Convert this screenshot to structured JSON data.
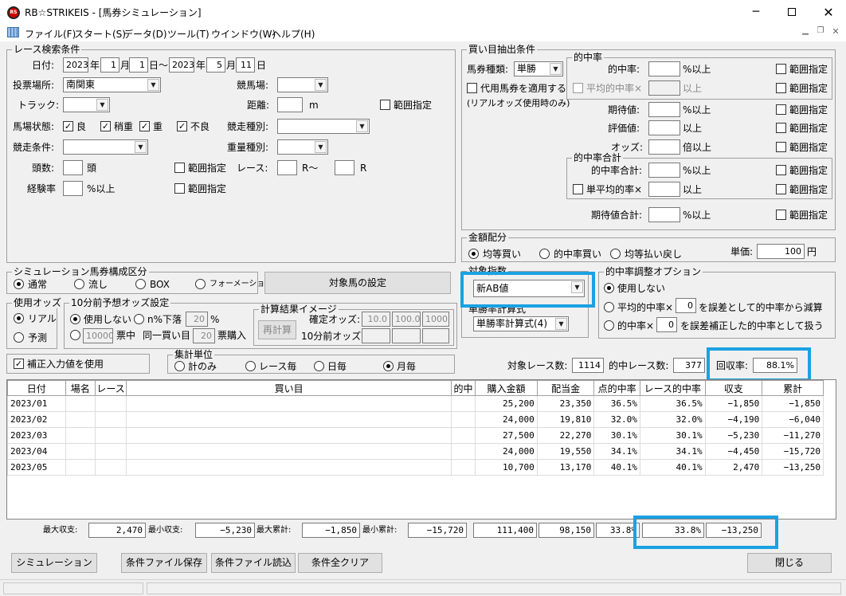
{
  "window": {
    "title": "RB☆STRIKEIS - [馬券シミュレーション]",
    "logo": "RS"
  },
  "menu": [
    "ファイル(F)",
    "スタート(S)",
    "データ(D)",
    "ツール(T)",
    "ウインドウ(W)",
    "ヘルプ(H)"
  ],
  "race_search": {
    "caption": "レース検索条件",
    "date_label": "日付:",
    "date_from_year": "2023",
    "year_char": "年",
    "date_from_month": "1",
    "month_char": "月",
    "date_from_day": "1",
    "day_char_range": "日〜",
    "date_to_year": "2023",
    "date_to_month": "5",
    "date_to_day": "11",
    "day_char": "日",
    "venue_label": "投票場所:",
    "venue_value": "南関東",
    "racecourse_label": "競馬場:",
    "racecourse_value": "",
    "track_label": "トラック:",
    "track_value": "",
    "distance_label": "距離:",
    "distance_value": "",
    "distance_unit": "m",
    "range_label": "範囲指定",
    "condition_label": "馬場状態:",
    "conditions": [
      "良",
      "稍重",
      "重",
      "不良"
    ],
    "race_type_label": "競走種別:",
    "race_type_value": "",
    "race_cond_label": "競走条件:",
    "race_cond_value": "",
    "weight_type_label": "重量種別:",
    "weight_type_value": "",
    "heads_label": "頭数:",
    "heads_value": "",
    "heads_unit": "頭",
    "race_label": "レース:",
    "race_from": "",
    "race_sep": "R〜",
    "race_to": "",
    "race_unit": "R",
    "exp_label": "経験率",
    "exp_value": "",
    "exp_unit": "%以上"
  },
  "buy_extract": {
    "caption": "買い目抽出条件",
    "bet_type_label": "馬券種類:",
    "bet_type_value": "単勝",
    "proxy_label": "代用馬券を適用する",
    "proxy_note": "(リアルオッズ使用時のみ)",
    "hit_rate_caption": "的中率",
    "hit_rate_label": "的中率:",
    "hit_rate_unit": "%以上",
    "avg_hit_label": "平均的中率×",
    "avg_hit_unit": "以上",
    "expect_label": "期待値:",
    "expect_unit": "%以上",
    "eval_label": "評価値:",
    "eval_unit": "以上",
    "odds_label": "オッズ:",
    "odds_unit": "倍以上",
    "hit_total_caption": "的中率合計",
    "hit_total_label": "的中率合計:",
    "hit_total_unit": "%以上",
    "single_avg_label": "単平均的率×",
    "single_avg_unit": "以上",
    "expect_total_label": "期待値合計:",
    "expect_total_unit": "%以上",
    "range_label": "範囲指定"
  },
  "allocation": {
    "caption": "金額配分",
    "options": [
      "均等買い",
      "的中率買い",
      "均等払い戻し"
    ],
    "unit_label": "単価:",
    "unit_value": "100",
    "unit_suffix": "円"
  },
  "sim_type": {
    "caption": "シミュレーション馬券構成区分",
    "options": [
      "通常",
      "流し",
      "BOX",
      "フォーメーション"
    ],
    "target_button": "対象馬の設定"
  },
  "odds_use": {
    "caption": "使用オッズ",
    "options": [
      "リアル",
      "予測"
    ]
  },
  "odds10": {
    "caption": "10分前予想オッズ設定",
    "not_use": "使用しない",
    "drop_label": "n%下落",
    "drop_value": "20",
    "drop_unit": "%",
    "votes_value": "10000",
    "votes_label": "票中",
    "same_label": "同一買い目",
    "same_value": "20",
    "same_unit": "票購入"
  },
  "calc_image": {
    "caption": "計算結果イメージ",
    "recalc_button": "再計算",
    "fixed_label": "確定オッズ:",
    "fixed_values": [
      "10.0",
      "100.0",
      "1000"
    ],
    "before_label": "10分前オッズ:"
  },
  "target_index": {
    "caption": "対象指数",
    "value": "新AB値",
    "calc_caption": "単勝率計算式",
    "calc_value": "単勝率計算式(4)"
  },
  "hit_adjust": {
    "caption": "的中率調整オプション",
    "option1": "使用しない",
    "option2_prefix": "平均的中率×",
    "option2_value": "0",
    "option2_suffix": "を誤差として的中率から減算",
    "option3_prefix": "的中率×",
    "option3_value": "0",
    "option3_suffix": "を誤差補正した的中率として扱う"
  },
  "correction": {
    "label": "補正入力値を使用"
  },
  "aggregate": {
    "caption": "集計単位",
    "options": [
      "計のみ",
      "レース毎",
      "日毎",
      "月毎"
    ]
  },
  "summary": {
    "target_races_label": "対象レース数:",
    "target_races": "1114",
    "hit_races_label": "的中レース数:",
    "hit_races": "377",
    "return_label": "回収率:",
    "return_value": "88.1%"
  },
  "table": {
    "headers": [
      "日付",
      "場名",
      "レース",
      "買い目",
      "的中",
      "購入金額",
      "配当金",
      "点的中率",
      "レース的中率",
      "収支",
      "累計"
    ],
    "rows": [
      [
        "2023/01",
        "",
        "",
        "",
        "",
        "25,200",
        "23,350",
        "36.5%",
        "36.5%",
        "−1,850",
        "−1,850"
      ],
      [
        "2023/02",
        "",
        "",
        "",
        "",
        "24,000",
        "19,810",
        "32.0%",
        "32.0%",
        "−4,190",
        "−6,040"
      ],
      [
        "2023/03",
        "",
        "",
        "",
        "",
        "27,500",
        "22,270",
        "30.1%",
        "30.1%",
        "−5,230",
        "−11,270"
      ],
      [
        "2023/04",
        "",
        "",
        "",
        "",
        "24,000",
        "19,550",
        "34.1%",
        "34.1%",
        "−4,450",
        "−15,720"
      ],
      [
        "2023/05",
        "",
        "",
        "",
        "",
        "10,700",
        "13,170",
        "40.1%",
        "40.1%",
        "2,470",
        "−13,250"
      ]
    ]
  },
  "footer": {
    "max_profit_label": "最大収支:",
    "max_profit": "2,470",
    "min_profit_label": "最小収支:",
    "min_profit": "−5,230",
    "max_cum_label": "最大累計:",
    "max_cum": "−1,850",
    "min_cum_label": "最小累計:",
    "min_cum": "−15,720",
    "total_buy": "111,400",
    "total_pay": "98,150",
    "total_point_hit": "33.8%",
    "total_race_hit": "33.8%",
    "total_profit": "−13,250"
  },
  "buttons": {
    "simulate": "シミュレーション",
    "save": "条件ファイル保存",
    "load": "条件ファイル読込",
    "clear": "条件全クリア",
    "close": "閉じる"
  },
  "colors": {
    "highlight": "#1ba1e2",
    "titlebar_bg": "#ffffff",
    "panel_bg": "#f0f0f0"
  }
}
